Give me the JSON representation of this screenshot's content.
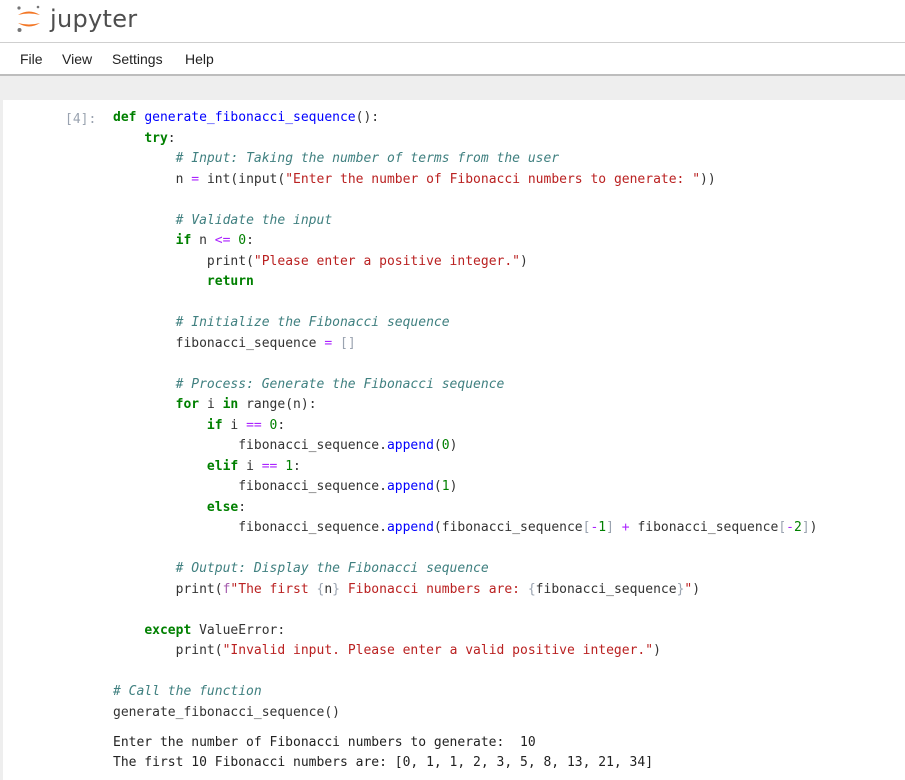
{
  "app": {
    "title": "jupyter"
  },
  "menu": {
    "items": [
      "File",
      "View",
      "Settings",
      "Help"
    ]
  },
  "cell": {
    "prompt": "[4]:",
    "lines": [
      "def generate_fibonacci_sequence():",
      "    try:",
      "        # Input: Taking the number of terms from the user",
      "        n = int(input(\"Enter the number of Fibonacci numbers to generate: \"))",
      "",
      "        # Validate the input",
      "        if n <= 0:",
      "            print(\"Please enter a positive integer.\")",
      "            return",
      "",
      "        # Initialize the Fibonacci sequence",
      "        fibonacci_sequence = []",
      "",
      "        # Process: Generate the Fibonacci sequence",
      "        for i in range(n):",
      "            if i == 0:",
      "                fibonacci_sequence.append(0)",
      "            elif i == 1:",
      "                fibonacci_sequence.append(1)",
      "            else:",
      "                fibonacci_sequence.append(fibonacci_sequence[-1] + fibonacci_sequence[-2])",
      "",
      "        # Output: Display the Fibonacci sequence",
      "        print(f\"The first {n} Fibonacci numbers are: {fibonacci_sequence}\")",
      "",
      "    except ValueError:",
      "        print(\"Invalid input. Please enter a valid positive integer.\")",
      "",
      "# Call the function",
      "generate_fibonacci_sequence()"
    ],
    "output": [
      "Enter the number of Fibonacci numbers to generate:  10",
      "The first 10 Fibonacci numbers are: [0, 1, 1, 2, 3, 5, 8, 13, 21, 34]"
    ]
  },
  "colors": {
    "keyword": "#008000",
    "comment": "#408080",
    "string": "#ba2121",
    "function": "#0000ff",
    "operator": "#aa22ff",
    "logo_orange": "#f37726"
  }
}
